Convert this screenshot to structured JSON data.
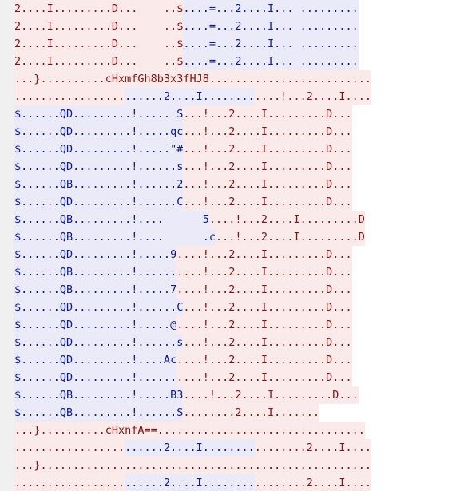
{
  "colors": {
    "red_text": "#8b1010",
    "red_background": "#fbeaea",
    "blue_text": "#0d1a94",
    "blue_background": "#eaeaf8",
    "blank_background": "#ffffff"
  },
  "lines": [
    [
      {
        "t": "2....I.........D...    ..$",
        "c": "r"
      },
      {
        "t": "....=...2....I... .........",
        "c": "b"
      }
    ],
    [
      {
        "t": "2....I.........D...    ..$",
        "c": "r"
      },
      {
        "t": "....=...2....I... .........",
        "c": "b"
      }
    ],
    [
      {
        "t": "2....I.........D...    ..$",
        "c": "r"
      },
      {
        "t": "....=...2....I... .........",
        "c": "b"
      }
    ],
    [
      {
        "t": "2....I.........D...    ..$",
        "c": "r"
      },
      {
        "t": "....=...2....I... .........",
        "c": "b"
      }
    ],
    [
      {
        "t": "...}..........cHxmfGh8b3x3fHJ8.........................",
        "c": "r"
      }
    ],
    [
      {
        "t": ".................",
        "c": "r"
      },
      {
        "t": "......2....I........",
        "c": "b"
      },
      {
        "t": "....!...2....I....",
        "c": "r"
      }
    ],
    [
      {
        "t": "$......QD.........!..... S",
        "c": "b"
      },
      {
        "t": "...!...2....I.........D...",
        "c": "r"
      }
    ],
    [
      {
        "t": "$......QD.........!.....qc",
        "c": "b"
      },
      {
        "t": "...!...2....I.........D...",
        "c": "r"
      }
    ],
    [
      {
        "t": "$......QD.........!.....\"#",
        "c": "b"
      },
      {
        "t": "...!...2....I.........D...",
        "c": "r"
      }
    ],
    [
      {
        "t": "$......QD.........!......s",
        "c": "b"
      },
      {
        "t": "...!...2....I.........D...",
        "c": "r"
      }
    ],
    [
      {
        "t": "$......QB.........!......2",
        "c": "b"
      },
      {
        "t": "...!...2....I.........D...",
        "c": "r"
      }
    ],
    [
      {
        "t": "$......QD.........!......C",
        "c": "b"
      },
      {
        "t": "...!...2....I.........D...",
        "c": "r"
      }
    ],
    [
      {
        "t": "$......QB.........!....      5",
        "c": "b"
      },
      {
        "t": "....!...2....I.........D",
        "c": "r"
      }
    ],
    [
      {
        "t": "$......QB.........!....      .c",
        "c": "b"
      },
      {
        "t": "...!...2....I.........D",
        "c": "r"
      }
    ],
    [
      {
        "t": "$......QD.........!.....9",
        "c": "b"
      },
      {
        "t": "....!...2....I.........D...",
        "c": "r"
      }
    ],
    [
      {
        "t": "$......QB.........!......",
        "c": "b"
      },
      {
        "t": "....!...2....I.........D...",
        "c": "r"
      }
    ],
    [
      {
        "t": "$......QB.........!.....7",
        "c": "b"
      },
      {
        "t": "....!...2....I.........D...",
        "c": "r"
      }
    ],
    [
      {
        "t": "$......QD.........!......C",
        "c": "b"
      },
      {
        "t": "...!...2....I.........D...",
        "c": "r"
      }
    ],
    [
      {
        "t": "$......QD.........!.....@",
        "c": "b"
      },
      {
        "t": "....!...2....I.........D...",
        "c": "r"
      }
    ],
    [
      {
        "t": "$......QD.........!......s",
        "c": "b"
      },
      {
        "t": "...!...2....I.........D...",
        "c": "r"
      }
    ],
    [
      {
        "t": "$......QD.........!....Ac",
        "c": "b"
      },
      {
        "t": "....!...2....I.........D...",
        "c": "r"
      }
    ],
    [
      {
        "t": "$......QD.........!......",
        "c": "b"
      },
      {
        "t": "....!...2....I.........D...",
        "c": "r"
      }
    ],
    [
      {
        "t": "$......QB.........!.....B3",
        "c": "b"
      },
      {
        "t": "....!...2....I.........D...",
        "c": "r"
      }
    ],
    [
      {
        "t": "$......QB.........!......S",
        "c": "b"
      },
      {
        "t": "........2....I.......",
        "c": "r"
      },
      {
        "t": "        ",
        "c": "w"
      }
    ],
    [
      {
        "t": "...}..........cHxnfA==................................",
        "c": "r"
      }
    ],
    [
      {
        "t": ".................",
        "c": "r"
      },
      {
        "t": "......2....I........",
        "c": "b"
      },
      {
        "t": "........2....I....",
        "c": "r"
      }
    ],
    [
      {
        "t": "...}...................................................",
        "c": "r"
      }
    ],
    [
      {
        "t": ".................",
        "c": "r"
      },
      {
        "t": "......2....I........",
        "c": "b"
      },
      {
        "t": "........2....I....",
        "c": "r"
      }
    ]
  ]
}
